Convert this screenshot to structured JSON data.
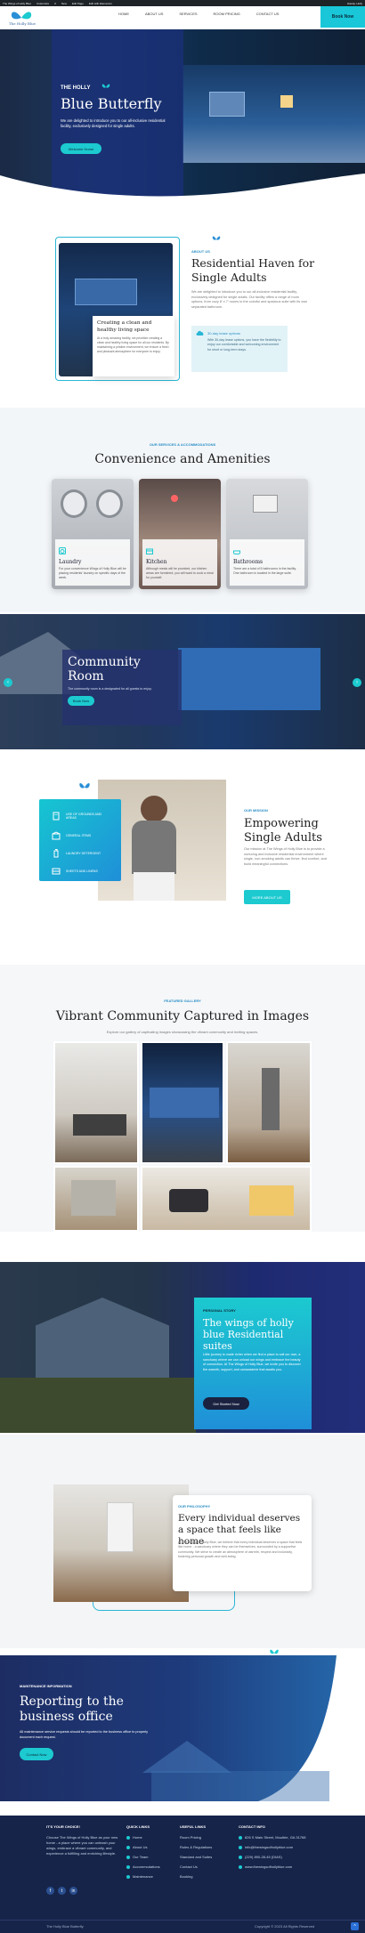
{
  "admin_bar": {
    "items": [
      "The Wings of Holly Blue",
      "Customize",
      "0",
      "New",
      "Edit Page",
      "Edit with Elementor"
    ],
    "right": "Howdy, Holly"
  },
  "header": {
    "logo_text": "The Holly Blue",
    "nav": [
      "HOME",
      "ABOUT US",
      "SERVICES",
      "ROOM PRICING",
      "CONTACT US"
    ],
    "book_label": "Book Now"
  },
  "hero": {
    "eyebrow": "THE HOLLY",
    "title": "Blue Butterfly",
    "subtitle": "We are delighted to introduce you to our all-inclusive residential facility, exclusively designed for single adults.",
    "cta": "Welcome Home"
  },
  "about": {
    "tag": "ABOUT US",
    "title": "Residential Haven for Single Adults",
    "body": "We are delighted to introduce you to our all-inclusive residential facility, exclusively designed for single adults. Our facility offers a range of room options, from cozy 8' x 7' rooms to the colorful and spacious suite with its own separated bathroom.",
    "card_title": "Creating a clean and healthy living space",
    "card_body": "At a truly amazing facility, we prioritize creating a clean and healthy living space for all our residents. By maintaining a pristine environment, we ensure a fresh and pleasant atmosphere for everyone to enjoy.",
    "note_title": "30-day lease options",
    "note_body": "With 30-day lease options, you have the flexibility to enjoy our comfortable and welcoming environment for short or long-term stays."
  },
  "services": {
    "tag": "OUR SERVICES & ACCOMMODATIONS",
    "title": "Convenience and Amenities",
    "cards": [
      {
        "title": "Laundry",
        "desc": "For your convenience Wings of Holly Blue will be placing residents' laundry on specific days of the week."
      },
      {
        "title": "Kitchen",
        "desc": "Although meals will be provided, our kitchen areas are furnished; you will want to cook a meal for yourself."
      },
      {
        "title": "Bathrooms",
        "desc": "There are a total of 5 bathrooms in the facility. One bathroom is located in the large suite."
      }
    ]
  },
  "community": {
    "title": "Community Room",
    "desc": "The community room is a designated for all guests to enjoy.",
    "cta": "Book Now"
  },
  "mission": {
    "features": [
      "USE OF GROUNDS AND AREAS",
      "GENERAL ITEMS",
      "LAUNDRY DETERGENT",
      "SHEETS AND LINENS"
    ],
    "tag": "OUR MISSION",
    "title": "Empowering Single Adults",
    "body": "Our mission at The Wings of Holly Blue is to provide a nurturing and inclusive residential environment where single, non-smoking adults can thrive, find comfort, and build meaningful connections.",
    "cta": "MORE ABOUT US"
  },
  "gallery": {
    "tag": "FEATURED GALLERY",
    "title": "Vibrant Community Captured in Images",
    "subtitle": "Explore our gallery of captivating images showcasing the vibrant community and inviting spaces."
  },
  "story": {
    "tag": "PERSONAL STORY",
    "title": "The wings of holly blue Residential suites",
    "body": "Little journey is made richer when we find a place to call our own, a sanctuary where we can unload our wings and embrace the beauty of connection. At The Wings of Holly Blue, we invite you to discover the warmth, support, and camaraderie that awaits you.",
    "cta": "Get Started Now"
  },
  "philosophy": {
    "tag": "OUR PHILOSOPHY",
    "title": "Every individual deserves a space that feels like home",
    "body": "At The Wings of Holly Blue, we believe that every individual deserves a space that feels like home - a sanctuary where they can be themselves, surrounded by a supportive community. We strive to create an atmosphere of warmth, respect and inclusivity, fostering personal growth and well-being."
  },
  "maintenance": {
    "tag": "MAINTENANCE INFORMATION",
    "title": "Reporting to the business office",
    "body": "All maintenance service requests should be reported to the business office to properly document each request.",
    "cta": "Contact Now"
  },
  "footer": {
    "about_head": "IT'S YOUR CHOICE!",
    "about_text": "Choose The Wings of Holly Blue as your new home - a place where you can unleash your wings, embrace a vibrant community, and experience a fulfilling and enriching lifestyle.",
    "quick_head": "QUICK LINKS",
    "quick": [
      "Home",
      "About Us",
      "Our Team",
      "Accommodations",
      "Maintenance"
    ],
    "useful_head": "USEFUL LINKS",
    "useful": [
      "Room Pricing",
      "Rules & Regulations",
      "Standard and Suites",
      "Contact Us",
      "Booking"
    ],
    "contact_head": "CONTACT INFO",
    "contact": [
      "826 S Main Street, Moultrie, GA 31768",
      "info@thewingsofhollyblue.com",
      "(229) 890-28-45 (DIAS)",
      "www.thewingsofhollyblue.com"
    ],
    "copyright_left": "The Holly Blue Butterfly",
    "copyright_right": "Copyright © 2023 All Rights Reserved"
  }
}
